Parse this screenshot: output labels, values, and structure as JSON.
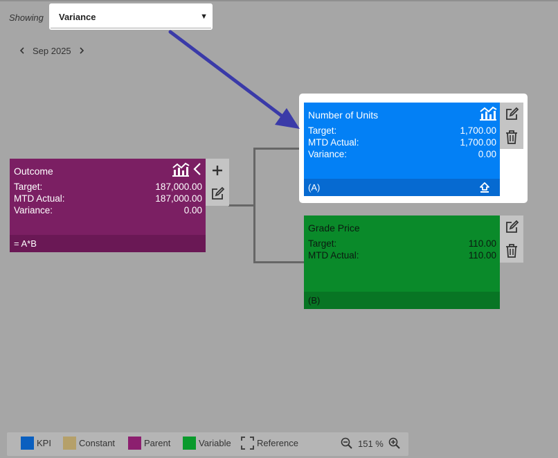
{
  "header": {
    "showing_label": "Showing",
    "selected_view": "Variance"
  },
  "period": {
    "month": "Sep 2025"
  },
  "nodes": {
    "outcome": {
      "title": "Outcome",
      "rows": [
        {
          "label": "Target:",
          "value": "187,000.00"
        },
        {
          "label": "MTD Actual:",
          "value": "187,000.00"
        },
        {
          "label": "Variance:",
          "value": "0.00"
        }
      ],
      "footer": "= A*B",
      "color": "#7b1f63",
      "footer_color": "#6a1855"
    },
    "units": {
      "title": "Number of Units",
      "rows": [
        {
          "label": "Target:",
          "value": "1,700.00"
        },
        {
          "label": "MTD Actual:",
          "value": "1,700.00"
        },
        {
          "label": "Variance:",
          "value": "0.00"
        }
      ],
      "footer": "(A)",
      "color": "#0380f5",
      "footer_color": "#066ad1"
    },
    "grade_price": {
      "title": "Grade Price",
      "rows": [
        {
          "label": "Target:",
          "value": "110.00"
        },
        {
          "label": "MTD Actual:",
          "value": "110.00"
        }
      ],
      "footer": "(B)",
      "color": "#0a8a2a",
      "footer_color": "#087524"
    }
  },
  "legend": {
    "items": [
      {
        "label": "KPI",
        "color": "#0a5fbf"
      },
      {
        "label": "Constant",
        "color": "#b5a06a"
      },
      {
        "label": "Parent",
        "color": "#8c1f6f"
      },
      {
        "label": "Variable",
        "color": "#0a9a2c"
      },
      {
        "label": "Reference",
        "color": "#444444"
      }
    ]
  },
  "zoom": {
    "level": "151 %"
  },
  "icons": [
    "chevron-left-icon",
    "chevron-right-icon",
    "chart-icon",
    "collapse-icon",
    "plus-icon",
    "edit-icon",
    "trash-icon",
    "upload-icon",
    "zoom-out-icon",
    "zoom-in-icon",
    "arrow-annotation"
  ]
}
